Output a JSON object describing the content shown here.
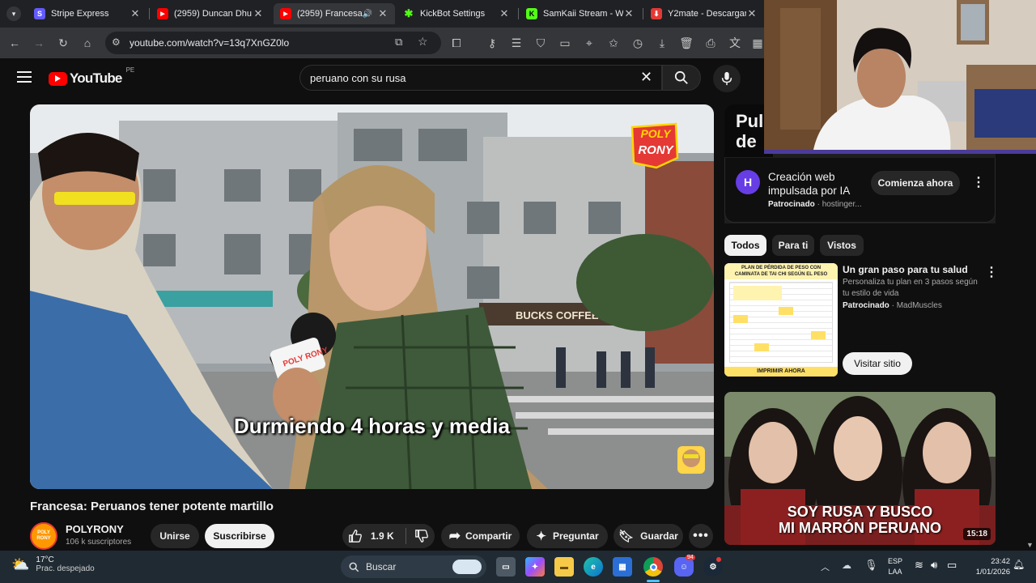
{
  "browser": {
    "tabs": [
      {
        "title": "Stripe Express",
        "favicon_color": "#635bff",
        "favicon_letter": "S"
      },
      {
        "title": "(2959) Duncan Dhu",
        "favicon_color": "#ff0000",
        "favicon_letter": "▶"
      },
      {
        "title": "(2959) Francesa:",
        "favicon_color": "#ff0000",
        "favicon_letter": "▶",
        "active": true
      },
      {
        "title": "KickBot Settings",
        "favicon_color": "#53fc18",
        "favicon_letter": "✱"
      },
      {
        "title": "SamKaii Stream - Wa",
        "favicon_color": "#53fc18",
        "favicon_letter": "K"
      },
      {
        "title": "Y2mate - Descargar",
        "favicon_color": "#e53935",
        "favicon_letter": "⬇"
      }
    ],
    "url": "youtube.com/watch?v=13q7XnGZ0lo"
  },
  "youtube": {
    "logo_text": "YouTube",
    "region": "PE",
    "search_query": "peruano con su rusa",
    "video": {
      "caption": "Durmiendo 4 horas y media",
      "logo_line1": "POLY",
      "logo_line2": "RONY",
      "mic_sticker": "POLY RONY"
    },
    "title": "Francesa: Peruanos tener potente martillo",
    "channel": {
      "name": "POLYRONY",
      "subscribers": "106 k suscriptores",
      "avatar_text": "POLY RONY"
    },
    "actions": {
      "join": "Unirse",
      "subscribe": "Suscribirse",
      "likes": "1.9 K",
      "share": "Compartir",
      "ask": "Preguntar",
      "save": "Guardar"
    },
    "sidebar": {
      "banner_text1": "Pul",
      "banner_text2": "de",
      "ad1": {
        "title": "Creación web impulsada por IA",
        "sponsored": "Patrocinado",
        "advertiser": "hostinger...",
        "cta": "Comienza ahora"
      },
      "chips": [
        "Todos",
        "Para ti",
        "Vistos"
      ],
      "ad2": {
        "title": "Un gran paso para tu salud",
        "description": "Personaliza tu plan en 3 pasos según tu estilo de vida",
        "sponsored": "Patrocinado",
        "advertiser": "MadMuscles",
        "cta": "Visitar sitio",
        "thumb_title1": "PLAN DE PÉRDIDA DE PESO CON",
        "thumb_title2": "CAMINATA DE TAI CHI SEGÚN EL PESO",
        "thumb_cta": "IMPRIMIR AHORA"
      },
      "rec_video": {
        "thumb_text1": "SOY RUSA Y BUSCO",
        "thumb_text2": "MI MARRÓN PERUANO",
        "duration": "15:18"
      }
    }
  },
  "taskbar": {
    "weather_temp": "17°C",
    "weather_desc": "Prac. despejado",
    "search_label": "Buscar",
    "lang1": "ESP",
    "lang2": "LAA",
    "time": "23:42",
    "date": "1/01/2026",
    "discord_badge": "94"
  }
}
